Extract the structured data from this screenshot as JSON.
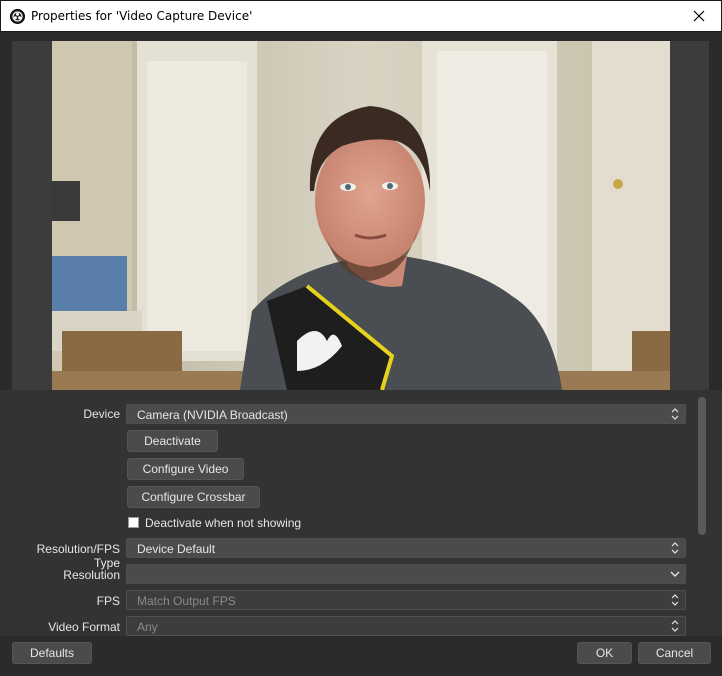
{
  "window": {
    "title": "Properties for 'Video Capture Device'",
    "app_icon": "obs-logo-icon",
    "close_icon": "close-icon"
  },
  "form": {
    "device": {
      "label": "Device",
      "value": "Camera (NVIDIA Broadcast)"
    },
    "deactivate_button": "Deactivate",
    "configure_video_button": "Configure Video",
    "configure_crossbar_button": "Configure Crossbar",
    "deactivate_when_not_showing": {
      "label": "Deactivate when not showing",
      "checked": false
    },
    "resolution_fps_type": {
      "label": "Resolution/FPS Type",
      "value": "Device Default"
    },
    "resolution": {
      "label": "Resolution",
      "value": ""
    },
    "fps": {
      "label": "FPS",
      "value": "Match Output FPS"
    },
    "video_format": {
      "label": "Video Format",
      "value": "Any"
    }
  },
  "footer": {
    "defaults_button": "Defaults",
    "ok_button": "OK",
    "cancel_button": "Cancel"
  },
  "colors": {
    "background": "#2b2b2b",
    "form_background": "#333333",
    "control": "#4b4b4b",
    "text": "#e6e6e6"
  }
}
